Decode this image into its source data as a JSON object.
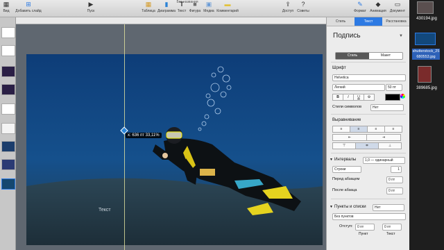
{
  "window": {
    "title": "Без названия"
  },
  "toolbar": {
    "view_label": "Вид",
    "add_slide_label": "Добавить слайд",
    "play_label": "Пуск",
    "table_label": "Таблица",
    "chart_label": "Диаграмма",
    "text_label": "Текст",
    "shape_label": "Фигура",
    "media_label": "Медиа",
    "comment_label": "Комментарий",
    "access_label": "Доступ",
    "tips_label": "Советы",
    "format_label": "Формат",
    "animate_label": "Анимация",
    "document_label": "Документ"
  },
  "canvas": {
    "tooltip": "x: 636 пт  33,11%",
    "placeholder_text": "Текст"
  },
  "inspector": {
    "tabs": [
      "Стиль",
      "Текст",
      "Расстановка"
    ],
    "active_tab": "Текст",
    "title": "Подпись",
    "segment": [
      "Стиль",
      "Макет"
    ],
    "font_section": "Шрифт",
    "font_family": "Helvetica",
    "font_style": "Легкий",
    "font_size": "50 пт",
    "bold": "B",
    "italic": "I",
    "underline": "U",
    "char_styles_label": "Стили символов",
    "char_styles_value": "Нет",
    "alignment_section": "Выравнивание",
    "spacing_label": "Интервалы",
    "spacing_value": "1,0 — одинарный",
    "lines_label": "Строки",
    "lines_value": "1",
    "before_label": "Перед абзацем",
    "before_value": "0 пт",
    "after_label": "После абзаца",
    "after_value": "0 пт",
    "bullets_label": "Пункты и списки",
    "bullets_value": "Нет",
    "no_bullets": "Без пунктов",
    "indent_label": "Отступ:",
    "indent_bullet_value": "0 пт",
    "indent_text_value": "0 пт",
    "bullet_caption": "Пункт",
    "text_caption": "Текст"
  },
  "files": [
    {
      "name": "430194.jpg"
    },
    {
      "name": "shutterstock_25 680553.jpg"
    },
    {
      "name": "389685.jpg"
    }
  ],
  "colors": {
    "accent": "#2d7ae3",
    "slide_bg": "#123f69"
  }
}
